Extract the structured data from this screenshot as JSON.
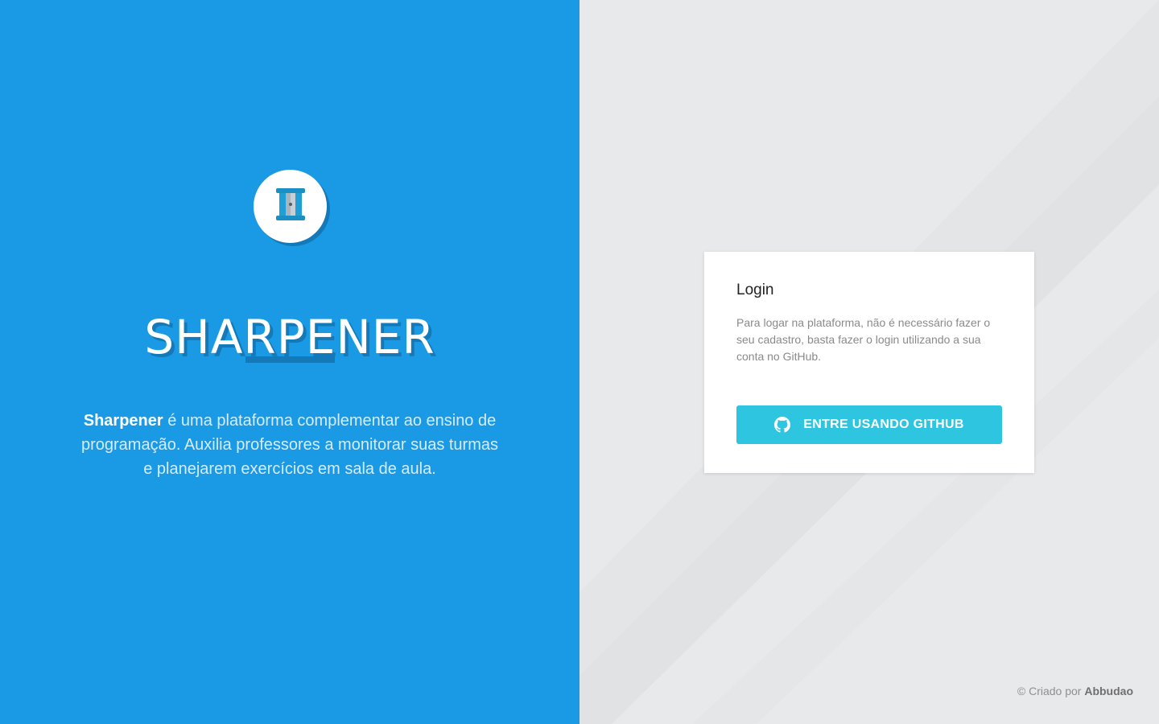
{
  "brand": {
    "name": "SHARPENER",
    "logo_icon": "pencil-sharpener-icon",
    "tagline_bold": "Sharpener",
    "tagline_rest": " é uma plataforma complementar ao ensino de programação. Auxilia professores a monitorar suas turmas e planejarem exercícios em sala de aula."
  },
  "login": {
    "title": "Login",
    "description": "Para logar na plataforma, não é necessário fazer o seu cadastro, basta fazer o login utilizando a sua conta no GitHub.",
    "button_label": "ENTRE USANDO GITHUB",
    "button_icon": "github-icon"
  },
  "footer": {
    "prefix": "© Criado por ",
    "author": "Abbudao"
  },
  "colors": {
    "left_bg": "#1a9ae4",
    "left_shadow": "#1479b8",
    "right_bg": "#e8e9eb",
    "button_bg": "#2dc5e0"
  }
}
